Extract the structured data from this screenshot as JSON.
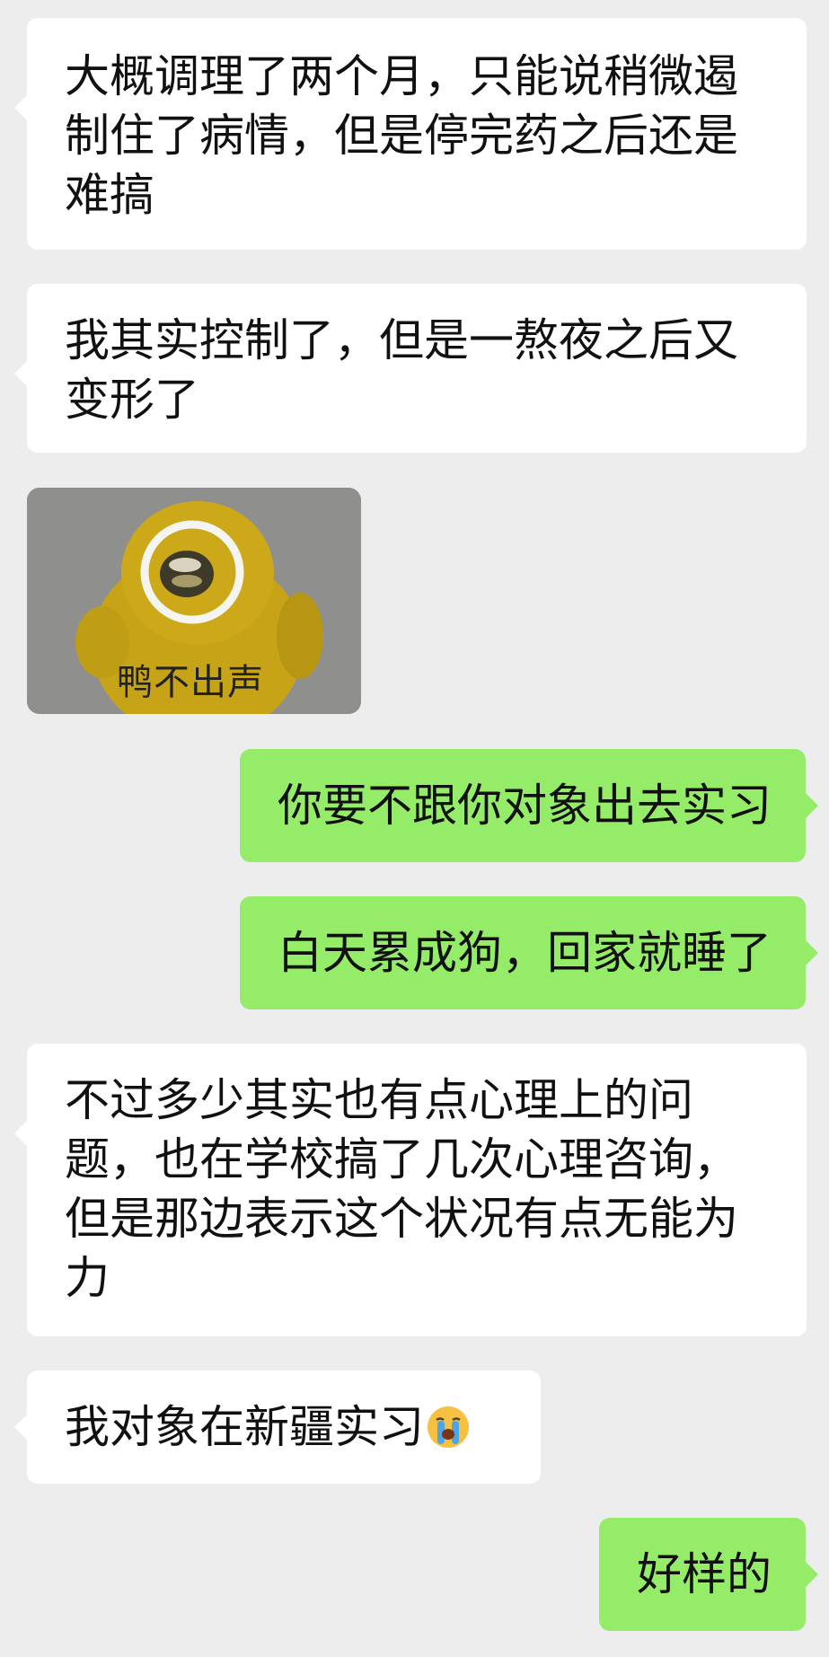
{
  "messages": [
    {
      "side": "left",
      "lines": [
        "大概调理了两个月，只能说稍微遏",
        "制住了病情，但是停完药之后还是",
        "难搞"
      ]
    },
    {
      "side": "left",
      "lines": [
        "我其实控制了，但是一熬夜之后又",
        "变形了"
      ]
    },
    {
      "side": "left",
      "type": "sticker",
      "caption": "鸭不出声",
      "icon": "yellow-duck-sticker"
    },
    {
      "side": "right",
      "lines": [
        "你要不跟你对象出去实习"
      ]
    },
    {
      "side": "right",
      "lines": [
        "白天累成狗，回家就睡了"
      ]
    },
    {
      "side": "left",
      "lines": [
        "不过多少其实也有点心理上的问",
        "题，也在学校搞了几次心理咨询，",
        "但是那边表示这个状况有点无能为",
        "力"
      ]
    },
    {
      "side": "left",
      "lines": [
        "我对象在新疆实习"
      ],
      "emoji": "crying-face-emoji"
    },
    {
      "side": "right",
      "lines": [
        "好样的"
      ]
    }
  ],
  "colors": {
    "background": "#ededed",
    "incoming_bubble": "#ffffff",
    "outgoing_bubble": "#95ec69",
    "text": "#111111"
  }
}
